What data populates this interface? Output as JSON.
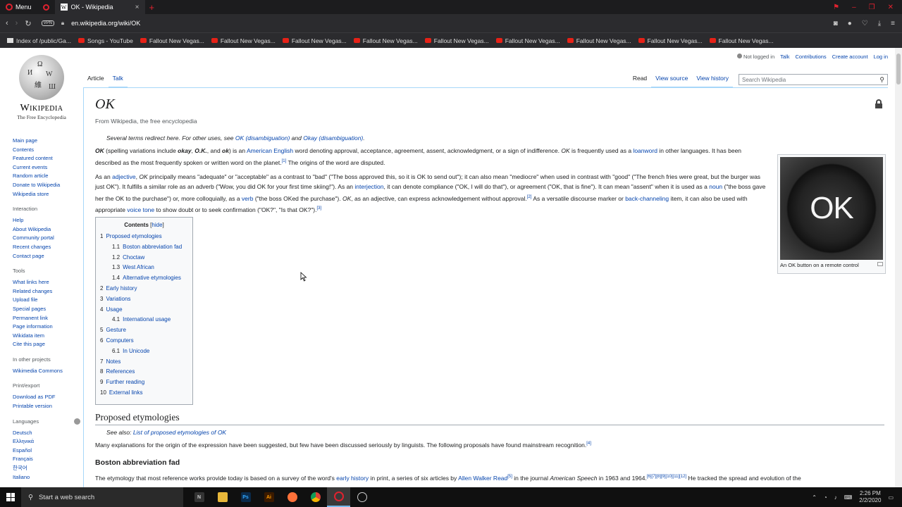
{
  "browser": {
    "menu_label": "Menu",
    "active_tab_title": "OK - Wikipedia",
    "url": "en.wikipedia.org/wiki/OK",
    "vpn_label": "VPN",
    "bookmarks": [
      {
        "label": "Index of /public/Ga...",
        "icon": "folder-icon"
      },
      {
        "label": "Songs - YouTube",
        "icon": "youtube-icon"
      },
      {
        "label": "Fallout New Vegas...",
        "icon": "youtube-icon"
      },
      {
        "label": "Fallout New Vegas...",
        "icon": "youtube-icon"
      },
      {
        "label": "Fallout New Vegas...",
        "icon": "youtube-icon"
      },
      {
        "label": "Fallout New Vegas...",
        "icon": "youtube-icon"
      },
      {
        "label": "Fallout New Vegas...",
        "icon": "youtube-icon"
      },
      {
        "label": "Fallout New Vegas...",
        "icon": "youtube-icon"
      },
      {
        "label": "Fallout New Vegas...",
        "icon": "youtube-icon"
      },
      {
        "label": "Fallout New Vegas...",
        "icon": "youtube-icon"
      },
      {
        "label": "Fallout New Vegas...",
        "icon": "youtube-icon"
      }
    ]
  },
  "wiki": {
    "wordmark": "Wikipedia",
    "tagline": "The Free Encyclopedia",
    "personal": {
      "not_logged_in": "Not logged in",
      "talk": "Talk",
      "contributions": "Contributions",
      "create_account": "Create account",
      "log_in": "Log in"
    },
    "tabs": {
      "article": "Article",
      "talk": "Talk",
      "read": "Read",
      "view_source": "View source",
      "view_history": "View history"
    },
    "search_placeholder": "Search Wikipedia",
    "sidebar": {
      "main": [
        "Main page",
        "Contents",
        "Featured content",
        "Current events",
        "Random article",
        "Donate to Wikipedia",
        "Wikipedia store"
      ],
      "interaction_head": "Interaction",
      "interaction": [
        "Help",
        "About Wikipedia",
        "Community portal",
        "Recent changes",
        "Contact page"
      ],
      "tools_head": "Tools",
      "tools": [
        "What links here",
        "Related changes",
        "Upload file",
        "Special pages",
        "Permanent link",
        "Page information",
        "Wikidata item",
        "Cite this page"
      ],
      "other_head": "In other projects",
      "other": [
        "Wikimedia Commons"
      ],
      "print_head": "Print/export",
      "print": [
        "Download as PDF",
        "Printable version"
      ],
      "languages_head": "Languages",
      "languages": [
        "Deutsch",
        "Ελληνικά",
        "Español",
        "Français",
        "한국어",
        "Italiano"
      ]
    },
    "title": "OK",
    "site_sub": "From Wikipedia, the free encyclopedia",
    "hatnote": {
      "prefix": "Several terms redirect here. For other uses, see ",
      "link1": "OK (disambiguation)",
      "mid": " and ",
      "link2": "Okay (disambiguation)",
      "suffix": "."
    },
    "infobox": {
      "image_text": "OK",
      "caption": "An OK button on a remote control"
    },
    "toc": {
      "title": "Contents",
      "hide": "hide",
      "items": [
        {
          "num": "1",
          "label": "Proposed etymologies",
          "level": 1
        },
        {
          "num": "1.1",
          "label": "Boston abbreviation fad",
          "level": 2
        },
        {
          "num": "1.2",
          "label": "Choctaw",
          "level": 2
        },
        {
          "num": "1.3",
          "label": "West African",
          "level": 2
        },
        {
          "num": "1.4",
          "label": "Alternative etymologies",
          "level": 2
        },
        {
          "num": "2",
          "label": "Early history",
          "level": 1
        },
        {
          "num": "3",
          "label": "Variations",
          "level": 1
        },
        {
          "num": "4",
          "label": "Usage",
          "level": 1
        },
        {
          "num": "4.1",
          "label": "International usage",
          "level": 2
        },
        {
          "num": "5",
          "label": "Gesture",
          "level": 1
        },
        {
          "num": "6",
          "label": "Computers",
          "level": 1
        },
        {
          "num": "6.1",
          "label": "In Unicode",
          "level": 2
        },
        {
          "num": "7",
          "label": "Notes",
          "level": 1
        },
        {
          "num": "8",
          "label": "References",
          "level": 1
        },
        {
          "num": "9",
          "label": "Further reading",
          "level": 1
        },
        {
          "num": "10",
          "label": "External links",
          "level": 1
        }
      ]
    },
    "section1": {
      "heading": "Proposed etymologies",
      "see_also_prefix": "See also: ",
      "see_also_link": "List of proposed etymologies of OK",
      "para": "Many explanations for the origin of the expression have been suggested, but few have been discussed seriously by linguists. The following proposals have found mainstream recognition.",
      "ref": "[4]"
    },
    "subsection": {
      "heading": "Boston abbreviation fad",
      "t1": "The etymology that most reference works provide today is based on a survey of the word's ",
      "l1": "early history",
      "t2": " in print, a series of six articles by ",
      "l2": "Allen Walker Read",
      "r1": "[5]",
      "t3": " in the journal ",
      "em": "American Speech",
      "t4": " in 1963 and 1964.",
      "r2": "[6][7][8][9][10][11][12]",
      "t5": " He tracked the spread and evolution of the"
    }
  },
  "taskbar": {
    "search_placeholder": "Start a web search",
    "time": "2:26 PM",
    "date": "2/2/2020"
  }
}
